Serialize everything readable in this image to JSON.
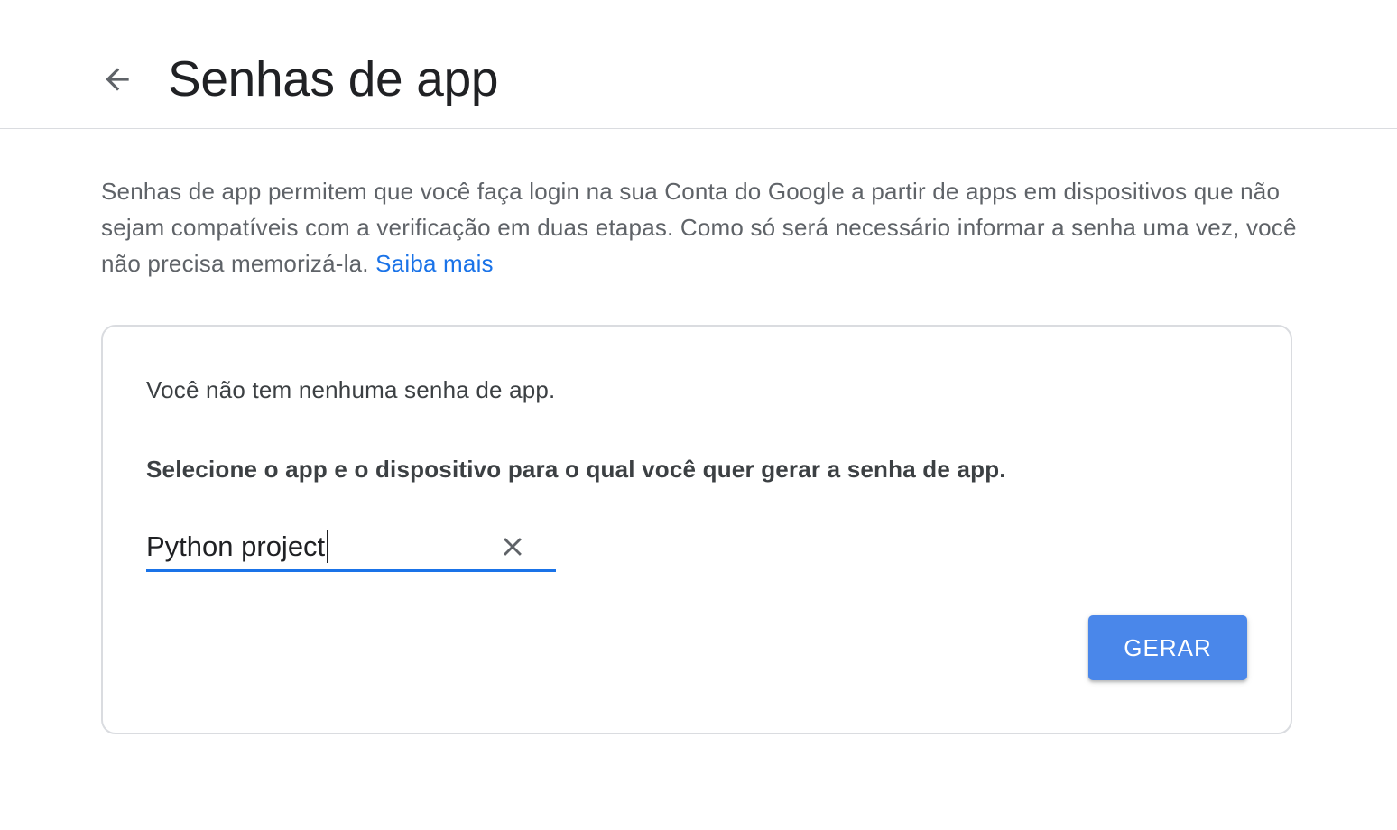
{
  "header": {
    "back_icon": "arrow-back-icon",
    "title": "Senhas de app"
  },
  "intro": {
    "text": "Senhas de app permitem que você faça login na sua Conta do Google a partir de apps em dispositivos que não sejam compatíveis com a verificação em duas etapas. Como só será necessário informar a senha uma vez, você não precisa memorizá-la.",
    "learn_more_label": "Saiba mais"
  },
  "card": {
    "empty_message": "Você não tem nenhuma senha de app.",
    "instruction": "Selecione o app e o dispositivo para o qual você quer gerar a senha de app.",
    "app_name_input": {
      "value": "Python project",
      "clear_icon": "close-icon"
    },
    "generate_label": "GERAR"
  },
  "colors": {
    "accent": "#1a73e8",
    "button": "#4a87ea",
    "title_text": "#202124",
    "body_text": "#5f6368",
    "divider": "#dadce0"
  }
}
